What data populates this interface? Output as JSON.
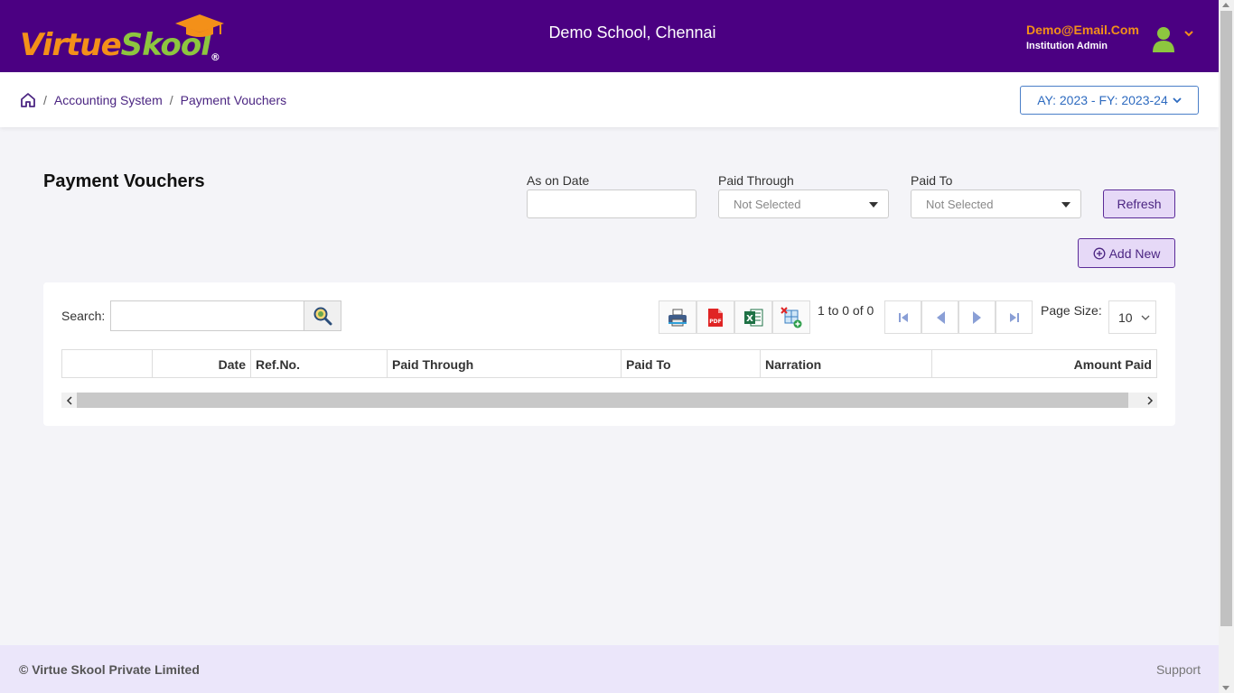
{
  "header": {
    "logo_part1": "Virtue",
    "logo_part2": "Skool",
    "logo_reg": "®",
    "school_name": "Demo School, Chennai",
    "user_email": "Demo@Email.Com",
    "user_role": "Institution Admin"
  },
  "breadcrumb": {
    "items": [
      "Accounting System",
      "Payment Vouchers"
    ],
    "separator": "/",
    "academic_year": "AY: 2023 - FY: 2023-24"
  },
  "page": {
    "title": "Payment Vouchers"
  },
  "filters": {
    "as_on_date_label": "As on Date",
    "as_on_date_value": "",
    "paid_through_label": "Paid Through",
    "paid_through_value": "Not Selected",
    "paid_to_label": "Paid To",
    "paid_to_value": "Not Selected",
    "refresh_label": "Refresh",
    "add_new_label": "Add New"
  },
  "grid": {
    "search_label": "Search:",
    "search_value": "",
    "pagination_info": "1 to 0 of 0",
    "page_size_label": "Page Size:",
    "page_size_value": "10",
    "columns": [
      "",
      "Date",
      "Ref.No.",
      "Paid Through",
      "Paid To",
      "Narration",
      "Amount Paid"
    ],
    "rows": []
  },
  "footer": {
    "copyright": "© Virtue Skool Private Limited",
    "support": "Support"
  },
  "colors": {
    "header_bg": "#4b0082",
    "accent_orange": "#f39019",
    "accent_green": "#8dc63f",
    "button_purple": "#5b2b98",
    "link_blue": "#2e6bc0"
  }
}
